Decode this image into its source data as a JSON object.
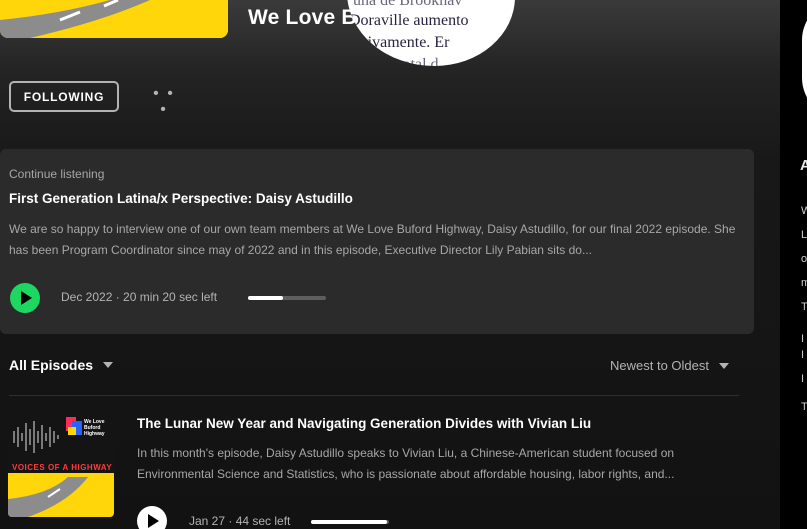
{
  "header": {
    "show_title": "We Love Buford Highway",
    "overlay_text": [
      "una de Brookhav",
      "Doraville aumento",
      "ectivamente. Er",
      "a total d"
    ]
  },
  "actions": {
    "follow_label": "FOLLOWING",
    "more_label": "• • •"
  },
  "continue_listening": {
    "label": "Continue listening",
    "title": "First Generation Latina/x Perspective: Daisy Astudillo",
    "description": "We are so happy to interview one of our own team members at We Love Buford Highway, Daisy Astudillo, for our final 2022 episode. She has been Program Coordinator since may of 2022 and in this episode, Executive Director Lily Pabian sits do...",
    "meta": "Dec 2022 · 20 min 20 sec left",
    "progress": 0.45
  },
  "episodes_bar": {
    "filter_label": "All Episodes",
    "sort_label": "Newest to Oldest"
  },
  "episode": {
    "art_title": "VOICES OF A HIGHWAY",
    "art_brand": "We Love Buford Highway",
    "title": "The Lunar New Year and Navigating Generation Divides with Vivian Liu",
    "description": "In this month's episode, Daisy Astudillo speaks to Vivian Liu, a Chinese-American student focused on Environmental Science and Statistics, who is passionate about affordable housing, labor rights, and...",
    "meta": "Jan 27 · 44 sec left",
    "progress": 0.97
  },
  "right_panel": {
    "heading": "A",
    "text_lines": [
      "W",
      "L",
      "o",
      "m",
      "T",
      "I",
      "I",
      "I",
      "T"
    ]
  },
  "colors": {
    "accent_green": "#1ed760",
    "cover_yellow": "#ffd60a",
    "text_secondary": "#a7a7a7"
  }
}
